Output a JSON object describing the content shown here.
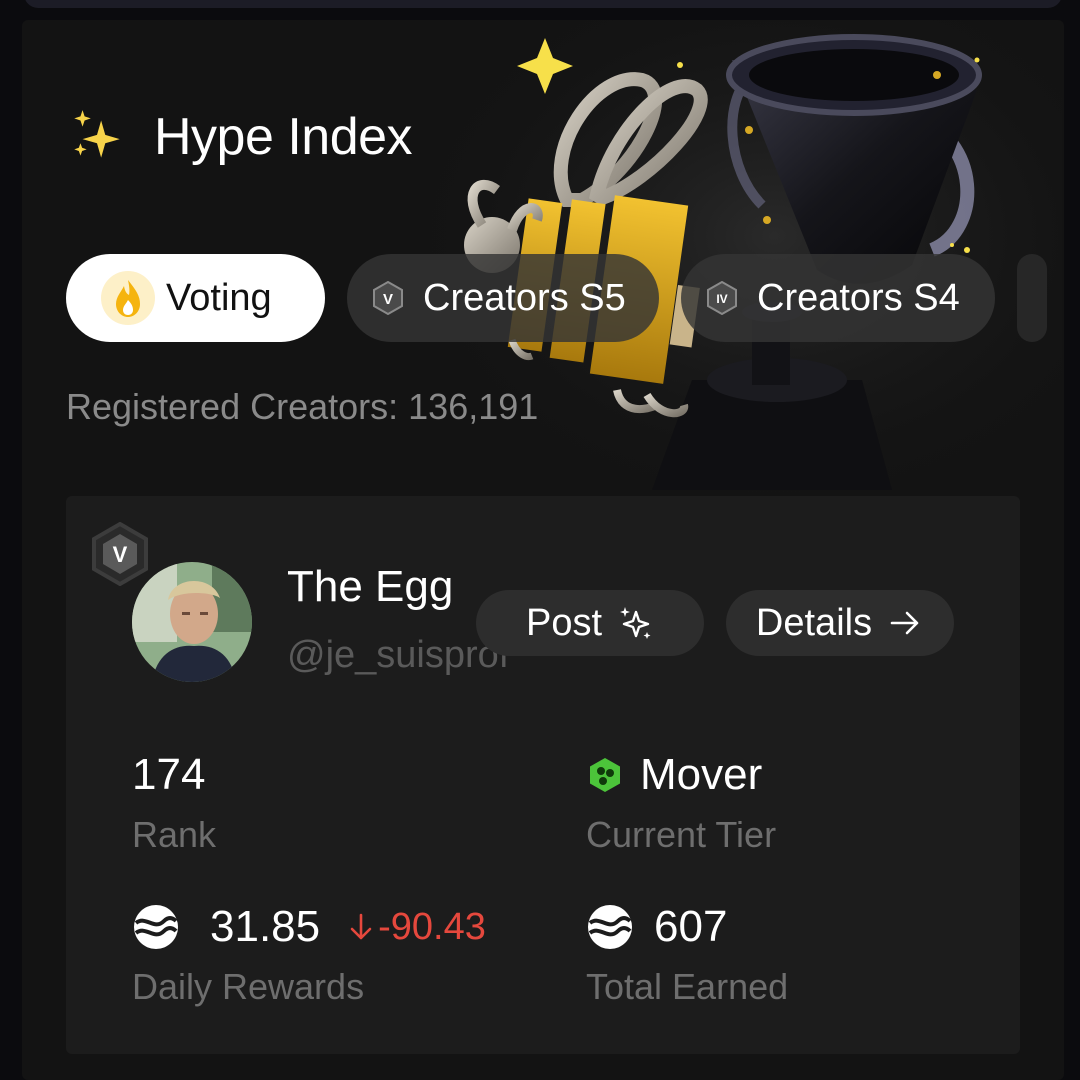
{
  "header": {
    "title": "Hype Index"
  },
  "tabs": [
    {
      "label": "Voting",
      "badge": "flame-icon",
      "active": true
    },
    {
      "label": "Creators S5",
      "badge": "V"
    },
    {
      "label": "Creators S4",
      "badge": "IV"
    }
  ],
  "registered": {
    "label": "Registered Creators:",
    "count": "136,191"
  },
  "creator": {
    "tier_badge": "V",
    "name": "The Egg",
    "handle": "@je_suisprof",
    "post_label": "Post",
    "details_label": "Details",
    "rank": "174",
    "rank_label": "Rank",
    "tier": "Mover",
    "tier_label": "Current Tier",
    "daily_rewards": "31.85",
    "daily_delta": "-90.43",
    "daily_label": "Daily Rewards",
    "total_earned": "607",
    "total_label": "Total Earned"
  },
  "colors": {
    "background": "#0b0b0e",
    "panel": "#131313",
    "card": "#1c1c1c",
    "negative": "#e5483d",
    "tier_green": "#4cc43a",
    "sparkle": "#f7d34a"
  }
}
